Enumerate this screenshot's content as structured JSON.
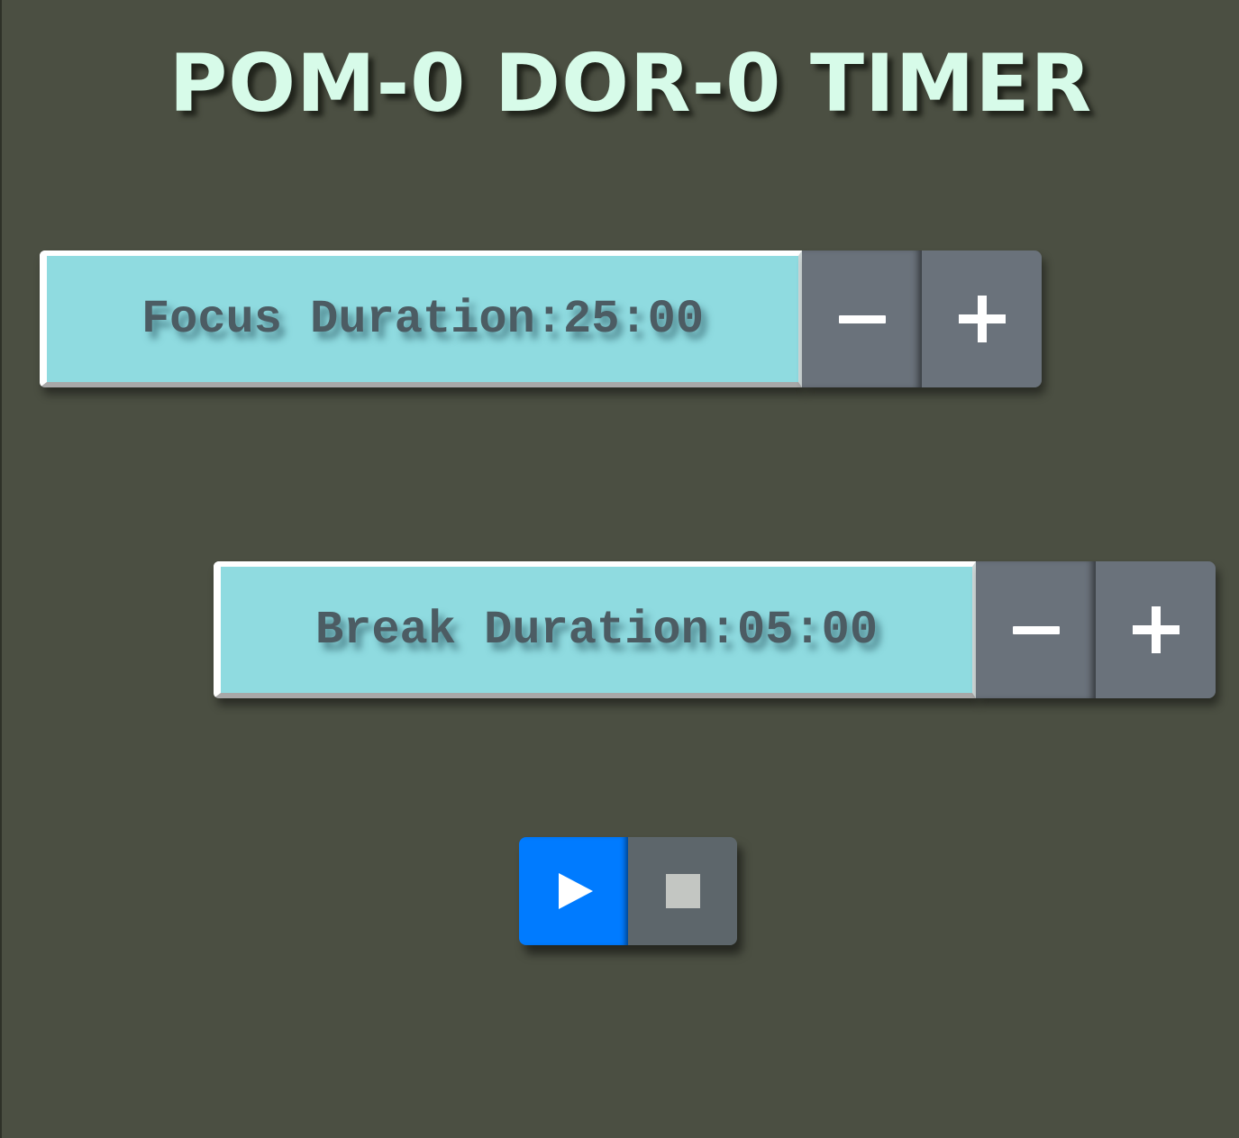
{
  "app": {
    "title": "POM-0 DOR-0 TIMER"
  },
  "focus": {
    "label": "Focus Duration:",
    "value": "25:00",
    "decrement_icon": "minus-icon",
    "increment_icon": "plus-icon"
  },
  "break": {
    "label": "Break Duration:",
    "value": "05:00",
    "decrement_icon": "minus-icon",
    "increment_icon": "plus-icon"
  },
  "controls": {
    "play_icon": "play-icon",
    "stop_icon": "stop-icon"
  },
  "colors": {
    "background": "#4b4f42",
    "title": "#d7fbe9",
    "display": "#8fdbe0",
    "display_text": "#4c5c63",
    "stepper": "#6a727b",
    "play": "#007bff",
    "stop": "#5d666b"
  }
}
